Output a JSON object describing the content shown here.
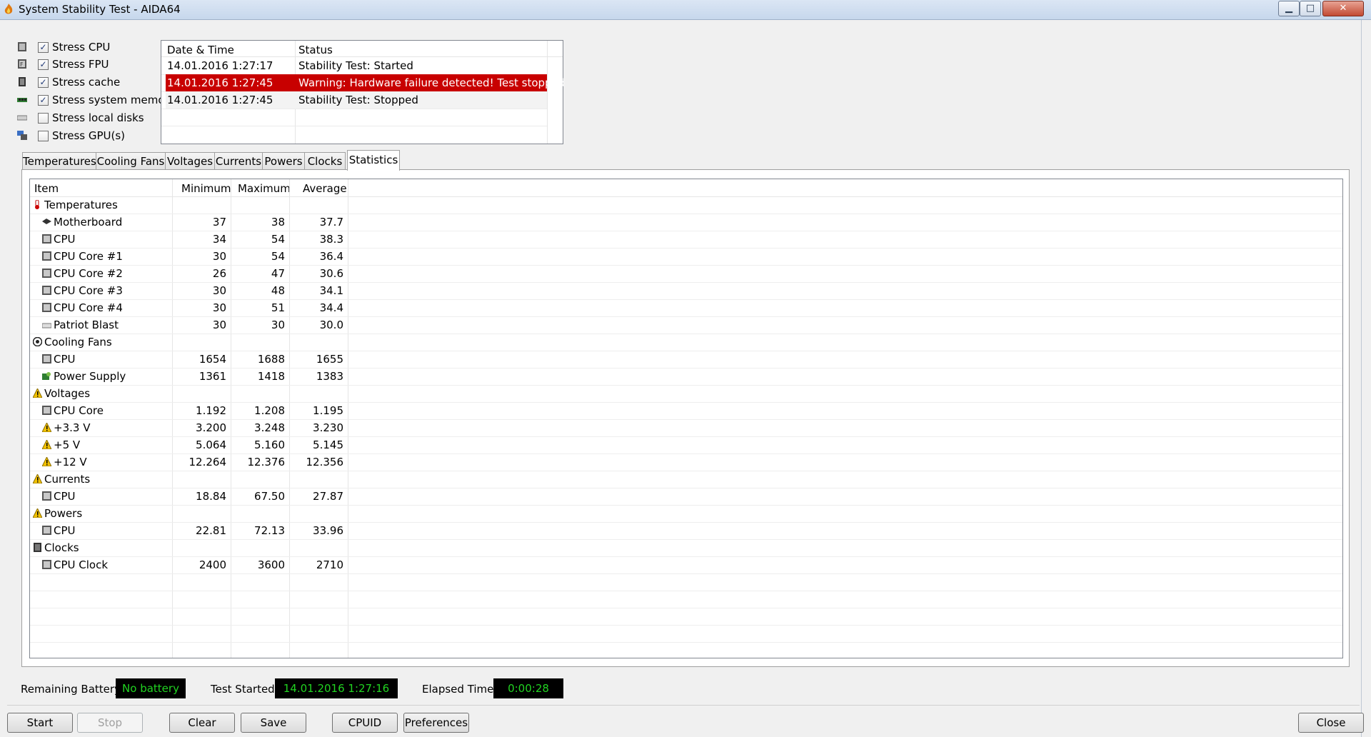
{
  "window": {
    "title": "System Stability Test - AIDA64",
    "minimize_glyph": "▁",
    "maximize_glyph": "□",
    "close_glyph": "✕"
  },
  "stress_options": [
    {
      "label": "Stress CPU",
      "checked": true,
      "icon": "cpu-icon"
    },
    {
      "label": "Stress FPU",
      "checked": true,
      "icon": "fpu-icon"
    },
    {
      "label": "Stress cache",
      "checked": true,
      "icon": "cache-icon"
    },
    {
      "label": "Stress system memory",
      "checked": true,
      "icon": "memory-icon"
    },
    {
      "label": "Stress local disks",
      "checked": false,
      "icon": "disk-icon"
    },
    {
      "label": "Stress GPU(s)",
      "checked": false,
      "icon": "gpu-icon"
    }
  ],
  "log": {
    "headers": {
      "datetime": "Date & Time",
      "status": "Status"
    },
    "rows": [
      {
        "datetime": "14.01.2016 1:27:17",
        "status": "Stability Test: Started",
        "alert": false
      },
      {
        "datetime": "14.01.2016 1:27:45",
        "status": "Warning: Hardware failure detected! Test stopped",
        "alert": true
      },
      {
        "datetime": "14.01.2016 1:27:45",
        "status": "Stability Test: Stopped",
        "alert": false
      }
    ]
  },
  "tabs": [
    "Temperatures",
    "Cooling Fans",
    "Voltages",
    "Currents",
    "Powers",
    "Clocks",
    "Statistics"
  ],
  "active_tab": "Statistics",
  "stats": {
    "headers": {
      "item": "Item",
      "minimum": "Minimum",
      "maximum": "Maximum",
      "average": "Average"
    },
    "rows": [
      {
        "item": "Temperatures",
        "group": true,
        "icon": "thermometer-icon"
      },
      {
        "item": "Motherboard",
        "min": "37",
        "max": "38",
        "avg": "37.7",
        "icon": "motherboard-icon"
      },
      {
        "item": "CPU",
        "min": "34",
        "max": "54",
        "avg": "38.3",
        "icon": "chip-icon"
      },
      {
        "item": "CPU Core #1",
        "min": "30",
        "max": "54",
        "avg": "36.4",
        "icon": "chip-icon"
      },
      {
        "item": "CPU Core #2",
        "min": "26",
        "max": "47",
        "avg": "30.6",
        "icon": "chip-icon"
      },
      {
        "item": "CPU Core #3",
        "min": "30",
        "max": "48",
        "avg": "34.1",
        "icon": "chip-icon"
      },
      {
        "item": "CPU Core #4",
        "min": "30",
        "max": "51",
        "avg": "34.4",
        "icon": "chip-icon"
      },
      {
        "item": "Patriot Blast",
        "min": "30",
        "max": "30",
        "avg": "30.0",
        "icon": "drive-icon"
      },
      {
        "item": "Cooling Fans",
        "group": true,
        "icon": "fan-icon"
      },
      {
        "item": "CPU",
        "min": "1654",
        "max": "1688",
        "avg": "1655",
        "icon": "chip-icon"
      },
      {
        "item": "Power Supply",
        "min": "1361",
        "max": "1418",
        "avg": "1383",
        "icon": "power-supply-icon"
      },
      {
        "item": "Voltages",
        "group": true,
        "icon": "warning-icon"
      },
      {
        "item": "CPU Core",
        "min": "1.192",
        "max": "1.208",
        "avg": "1.195",
        "icon": "chip-icon"
      },
      {
        "item": "+3.3 V",
        "min": "3.200",
        "max": "3.248",
        "avg": "3.230",
        "icon": "warning-icon"
      },
      {
        "item": "+5 V",
        "min": "5.064",
        "max": "5.160",
        "avg": "5.145",
        "icon": "warning-icon"
      },
      {
        "item": "+12 V",
        "min": "12.264",
        "max": "12.376",
        "avg": "12.356",
        "icon": "warning-icon"
      },
      {
        "item": "Currents",
        "group": true,
        "icon": "warning-icon"
      },
      {
        "item": "CPU",
        "min": "18.84",
        "max": "67.50",
        "avg": "27.87",
        "icon": "chip-icon"
      },
      {
        "item": "Powers",
        "group": true,
        "icon": "warning-icon"
      },
      {
        "item": "CPU",
        "min": "22.81",
        "max": "72.13",
        "avg": "33.96",
        "icon": "chip-icon"
      },
      {
        "item": "Clocks",
        "group": true,
        "icon": "clock-chip-icon"
      },
      {
        "item": "CPU Clock",
        "min": "2400",
        "max": "3600",
        "avg": "2710",
        "icon": "chip-icon"
      }
    ]
  },
  "status_bar": {
    "battery_label": "Remaining Battery:",
    "battery_value": "No battery",
    "started_label": "Test Started:",
    "started_value": "14.01.2016 1:27:16",
    "elapsed_label": "Elapsed Time:",
    "elapsed_value": "0:00:28"
  },
  "buttons": {
    "start": "Start",
    "stop": "Stop",
    "clear": "Clear",
    "save": "Save",
    "cpuid": "CPUID",
    "preferences": "Preferences",
    "close": "Close"
  },
  "colors": {
    "alert_row": "#c80000",
    "status_box_bg": "#000000",
    "status_box_text": "#21d321"
  }
}
